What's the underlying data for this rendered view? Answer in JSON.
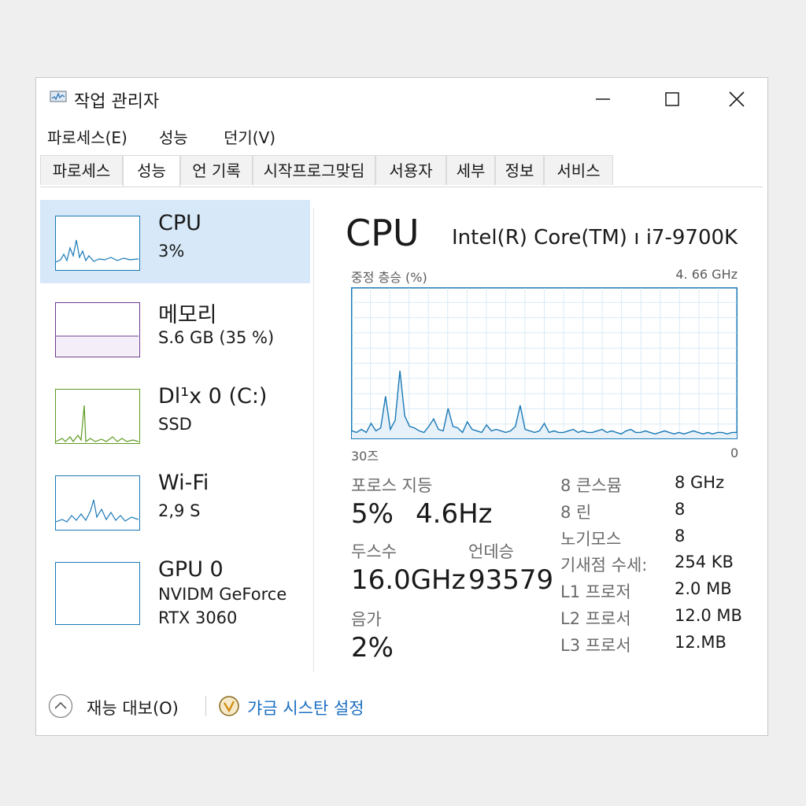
{
  "window": {
    "title": "작업 관리자"
  },
  "menu": [
    "파로세스(E)",
    "성능",
    "던기(V)"
  ],
  "tabs": [
    "파로세스",
    "성능",
    "언 기록",
    "시작프로그맞딤",
    "서용자",
    "세부",
    "정보",
    "서비스"
  ],
  "sidebar": {
    "items": [
      {
        "name": "CPU",
        "sub1": "3%",
        "sub2": ""
      },
      {
        "name": "메모리",
        "sub1": "S.6 GB (35 %)",
        "sub2": ""
      },
      {
        "name": "Dl¹x 0 (C:)",
        "sub1": "SSD",
        "sub2": ""
      },
      {
        "name": "Wi-Fi",
        "sub1": "2,9 S",
        "sub2": ""
      },
      {
        "name": "GPU 0",
        "sub1": "NVIDM GeForce",
        "sub2": "RTX 3060"
      }
    ]
  },
  "main": {
    "title": "CPU",
    "model": "Intel(R) Core(TM) ı i7-9700K",
    "graph_label": "중정 층승 (%)",
    "graph_max": "4. 66 GHz",
    "axis_left": "30즈",
    "axis_right": "0",
    "stats": {
      "util_label": "포로스 지등",
      "util_value": "5%",
      "speed_value": "4.6Hz",
      "procs_label": "두스수",
      "procs_value": "16.0GHz",
      "threads_label": "언데승",
      "threads_value": "93579",
      "handles_label": "음가",
      "handles_value": "2%"
    },
    "specs": [
      {
        "key": "8 큰스뮴",
        "value": "8 GHz"
      },
      {
        "key": "8 린",
        "value": "8"
      },
      {
        "key": "노기모스",
        "value": "8"
      },
      {
        "key": "기새점 수세:",
        "value": "254 KB"
      },
      {
        "key": "L1 프로저",
        "value": "2.0 MB"
      },
      {
        "key": "L2 프로서",
        "value": "12.0 MB"
      },
      {
        "key": "L3 프로서",
        "value": "12.MB"
      }
    ]
  },
  "footer": {
    "fewer_details": "재능 대보(O)",
    "open_monitor": "갸금 시스탄 설정"
  },
  "colors": {
    "accent_blue": "#1a6fc2",
    "cpu_line": "#1979b6",
    "disk_line": "#5d9b1e",
    "memory_border": "#6b3a8e",
    "selection": "#d7e9f9"
  },
  "chart_data": {
    "type": "line",
    "series": [
      {
        "values": [
          5,
          4,
          6,
          4,
          10,
          5,
          7,
          28,
          6,
          12,
          45,
          15,
          8,
          7,
          5,
          4,
          8,
          13,
          6,
          5,
          20,
          8,
          7,
          4,
          11,
          6,
          5,
          4,
          9,
          5,
          6,
          5,
          4,
          5,
          8,
          22,
          6,
          5,
          4,
          5,
          10,
          4,
          5,
          4,
          4,
          5,
          6,
          4,
          5,
          4,
          4,
          5,
          6,
          4,
          5,
          4,
          3,
          5,
          6,
          4,
          4,
          5,
          4,
          3,
          4,
          5,
          4,
          3,
          4,
          3,
          4,
          5,
          4,
          3,
          4,
          3,
          4,
          4,
          3,
          4,
          4
        ]
      }
    ],
    "ylim": [
      0,
      100
    ]
  }
}
